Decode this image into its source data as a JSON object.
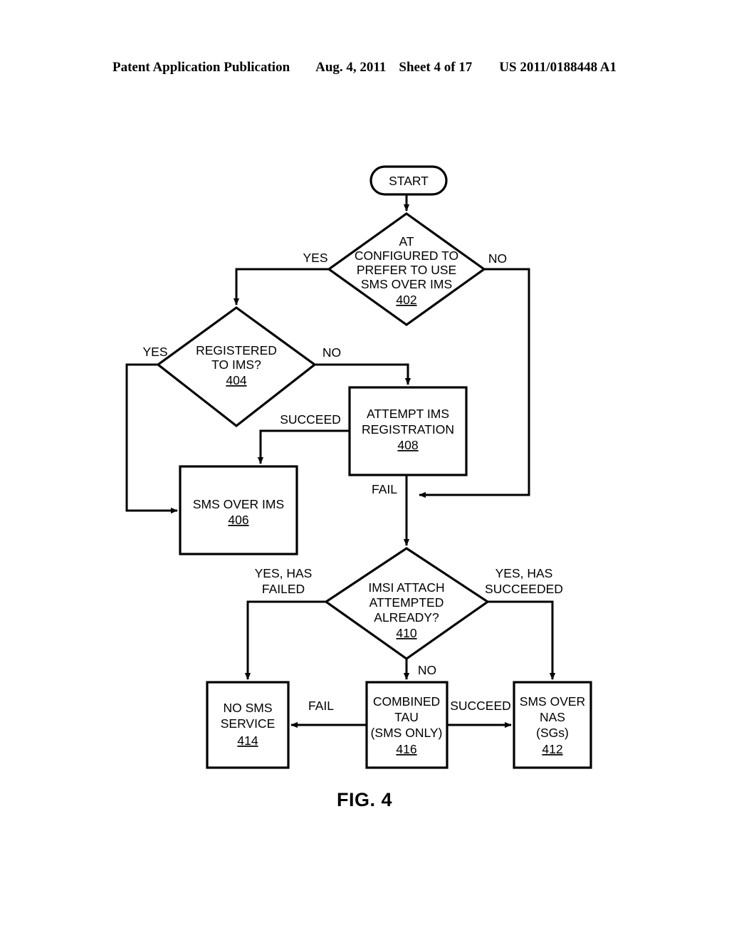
{
  "header": {
    "publication": "Patent Application Publication",
    "date": "Aug. 4, 2011",
    "sheet": "Sheet 4 of 17",
    "patent_number": "US 2011/0188448 A1"
  },
  "figure": {
    "caption": "FIG. 4"
  },
  "chart_data": {
    "type": "diagram",
    "title": "FIG. 4",
    "nodes": [
      {
        "id": "start",
        "shape": "rounded",
        "lines": [
          "START"
        ],
        "ref": ""
      },
      {
        "id": "402",
        "shape": "diamond",
        "lines": [
          "AT",
          "CONFIGURED TO",
          "PREFER TO USE",
          "SMS OVER IMS"
        ],
        "ref": "402"
      },
      {
        "id": "404",
        "shape": "diamond",
        "lines": [
          "REGISTERED",
          "TO IMS?"
        ],
        "ref": "404"
      },
      {
        "id": "408",
        "shape": "rect",
        "lines": [
          "ATTEMPT IMS",
          "REGISTRATION"
        ],
        "ref": "408"
      },
      {
        "id": "406",
        "shape": "rect",
        "lines": [
          "SMS OVER IMS"
        ],
        "ref": "406"
      },
      {
        "id": "410",
        "shape": "diamond",
        "lines": [
          "IMSI ATTACH",
          "ATTEMPTED",
          "ALREADY?"
        ],
        "ref": "410"
      },
      {
        "id": "414",
        "shape": "rect",
        "lines": [
          "NO SMS",
          "SERVICE"
        ],
        "ref": "414"
      },
      {
        "id": "416",
        "shape": "rect",
        "lines": [
          "COMBINED",
          "TAU",
          "(SMS ONLY)"
        ],
        "ref": "416"
      },
      {
        "id": "412",
        "shape": "rect",
        "lines": [
          "SMS OVER",
          "NAS",
          "(SGs)"
        ],
        "ref": "412"
      }
    ],
    "edges": [
      {
        "from": "start",
        "to": "402",
        "label": ""
      },
      {
        "from": "402",
        "to": "404",
        "label": "YES"
      },
      {
        "from": "402",
        "to": "junction-fail",
        "label": "NO"
      },
      {
        "from": "404",
        "to": "406",
        "label": "YES"
      },
      {
        "from": "404",
        "to": "408",
        "label": "NO"
      },
      {
        "from": "408",
        "to": "406",
        "label": "SUCCEED"
      },
      {
        "from": "408",
        "to": "410",
        "label": "FAIL"
      },
      {
        "from": "410",
        "to": "414",
        "label": "YES, HAS FAILED"
      },
      {
        "from": "410",
        "to": "412",
        "label": "YES, HAS SUCCEEDED"
      },
      {
        "from": "410",
        "to": "416",
        "label": "NO"
      },
      {
        "from": "416",
        "to": "414",
        "label": "FAIL"
      },
      {
        "from": "416",
        "to": "412",
        "label": "SUCCEED"
      }
    ]
  },
  "labels": {
    "start": "START",
    "d402_l1": "AT",
    "d402_l2": "CONFIGURED TO",
    "d402_l3": "PREFER TO USE",
    "d402_l4": "SMS OVER IMS",
    "d402_ref": "402",
    "d404_l1": "REGISTERED",
    "d404_l2": "TO IMS?",
    "d404_ref": "404",
    "b408_l1": "ATTEMPT IMS",
    "b408_l2": "REGISTRATION",
    "b408_ref": "408",
    "b406_l1": "SMS OVER IMS",
    "b406_ref": "406",
    "d410_l1": "IMSI ATTACH",
    "d410_l2": "ATTEMPTED",
    "d410_l3": "ALREADY?",
    "d410_ref": "410",
    "b414_l1": "NO SMS",
    "b414_l2": "SERVICE",
    "b414_ref": "414",
    "b416_l1": "COMBINED",
    "b416_l2": "TAU",
    "b416_l3": "(SMS ONLY)",
    "b416_ref": "416",
    "b412_l1": "SMS OVER",
    "b412_l2": "NAS",
    "b412_l3": "(SGs)",
    "b412_ref": "412",
    "e_yes_402": "YES",
    "e_no_402": "NO",
    "e_yes_404": "YES",
    "e_no_404": "NO",
    "e_succeed_408": "SUCCEED",
    "e_fail_408": "FAIL",
    "e_yes_failed_1": "YES, HAS",
    "e_yes_failed_2": "FAILED",
    "e_yes_succeeded_1": "YES, HAS",
    "e_yes_succeeded_2": "SUCCEEDED",
    "e_no_410": "NO",
    "e_fail_416": "FAIL",
    "e_succeed_416": "SUCCEED"
  }
}
